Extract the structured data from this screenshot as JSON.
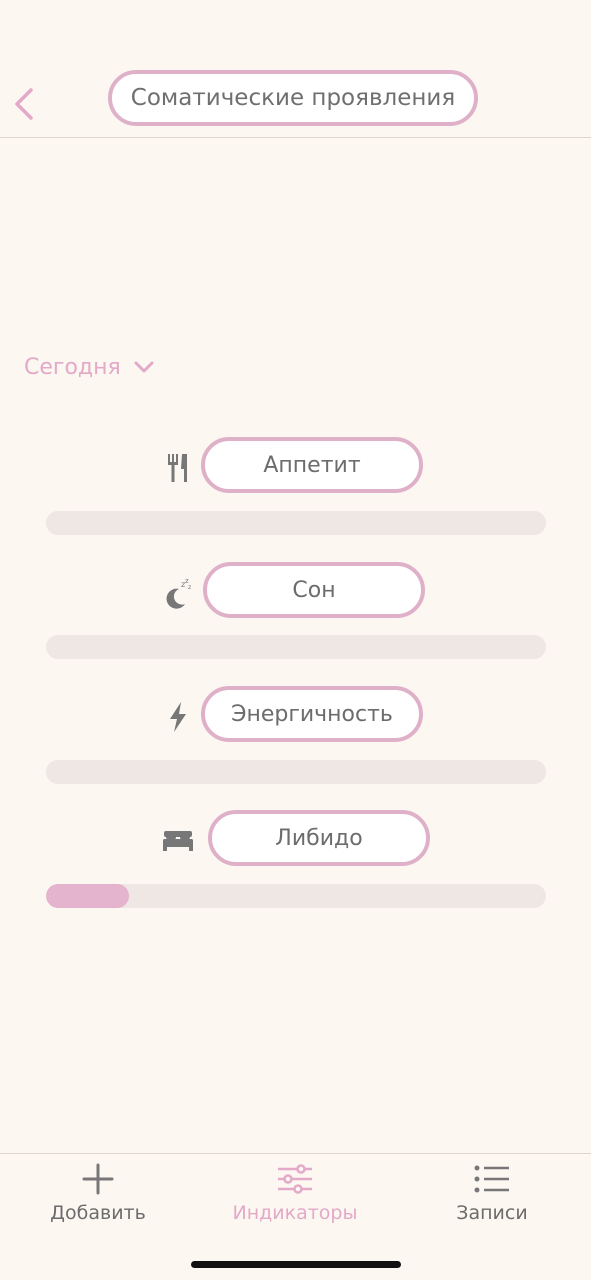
{
  "header": {
    "title": "Соматические проявления"
  },
  "date_selector": {
    "label": "Сегодня"
  },
  "indicators": [
    {
      "label": "Аппетит",
      "icon": "fork-knife-icon",
      "level": 0
    },
    {
      "label": "Сон",
      "icon": "sleep-moon-icon",
      "level": 0
    },
    {
      "label": "Энергичность",
      "icon": "lightning-icon",
      "level": 0
    },
    {
      "label": "Либидо",
      "icon": "bed-icon",
      "level": 0.165
    }
  ],
  "tabbar": {
    "items": [
      {
        "label": "Добавить",
        "icon": "plus-icon",
        "active": false
      },
      {
        "label": "Индикаторы",
        "icon": "sliders-icon",
        "active": true
      },
      {
        "label": "Записи",
        "icon": "list-icon",
        "active": false
      }
    ]
  },
  "colors": {
    "background": "#fdf7f2",
    "accent_pink": "#dfb1c9",
    "text_gray": "#6c6c6c",
    "track": "#eee7e3",
    "fill": "#e4b3cd"
  }
}
